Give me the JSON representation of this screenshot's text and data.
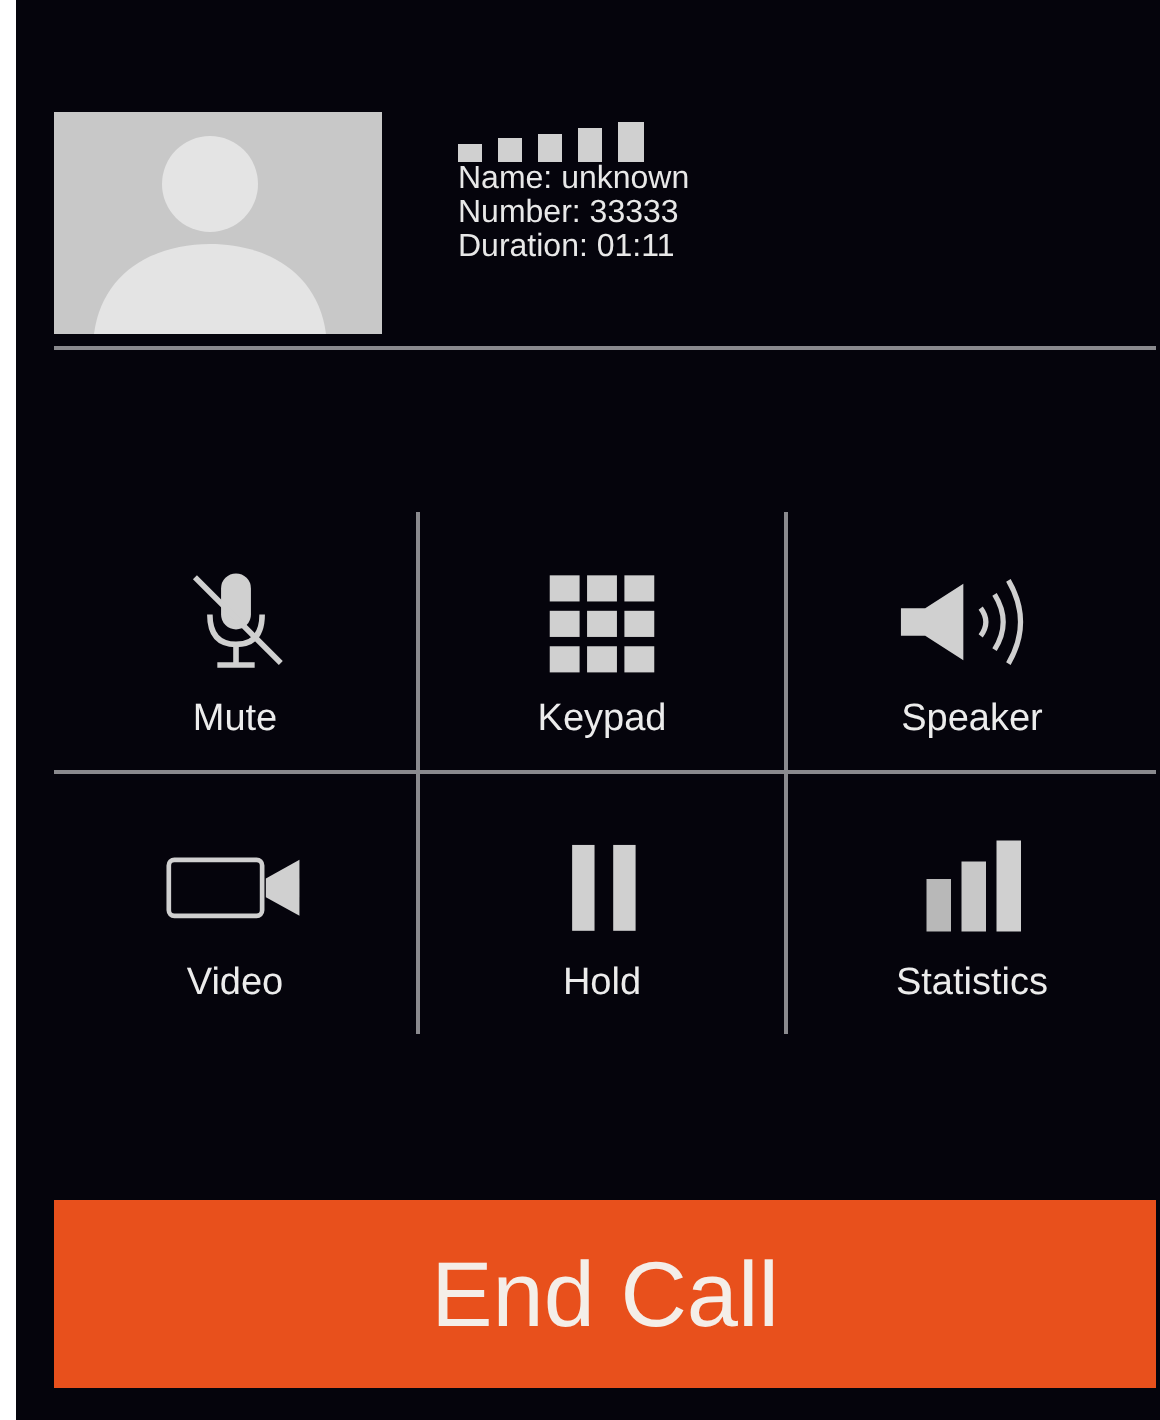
{
  "caller": {
    "name": "Name: unknown",
    "number": "Number: 33333",
    "duration": "Duration: 01:11"
  },
  "controls": [
    {
      "label": "Mute"
    },
    {
      "label": "Keypad"
    },
    {
      "label": "Speaker"
    },
    {
      "label": "Video"
    },
    {
      "label": "Hold"
    },
    {
      "label": "Statistics"
    }
  ],
  "end_button": {
    "label": "End Call"
  }
}
